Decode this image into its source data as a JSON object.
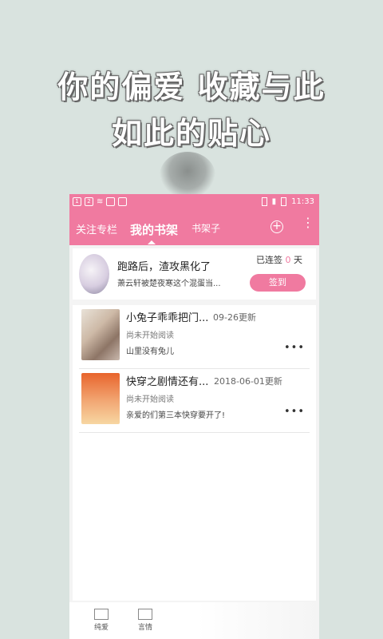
{
  "promo": {
    "line1": "你的偏爱  收藏与此",
    "line2": "如此的贴心"
  },
  "status_bar": {
    "time": "11:33"
  },
  "tabs": [
    {
      "label": "关注专栏"
    },
    {
      "label": "我的书架",
      "active": true
    },
    {
      "label": "书架子"
    }
  ],
  "header_icons": [
    "plus-icon",
    "more-vertical-icon"
  ],
  "signin_card": {
    "book_title": "跑路后，渣攻黑化了",
    "book_excerpt": "萧云轩被楚夜寒这个混蛋当...",
    "streak_prefix": "已连签",
    "streak_days": "0",
    "streak_suffix": "天",
    "button": "签到"
  },
  "books": [
    {
      "title": "小兔子乖乖把门...",
      "date": "09-26更新",
      "progress": "尚未开始阅读",
      "description": "山里没有兔儿"
    },
    {
      "title": "快穿之剧情还有...",
      "date": "2018-06-01更新",
      "progress": "尚未开始阅读",
      "description": "亲爱的们第三本快穿要开了!"
    }
  ],
  "bottom_nav": [
    {
      "label": "纯爱"
    },
    {
      "label": "言情"
    }
  ],
  "colors": {
    "accent": "#f07aa0",
    "background": "#d9e3df"
  }
}
